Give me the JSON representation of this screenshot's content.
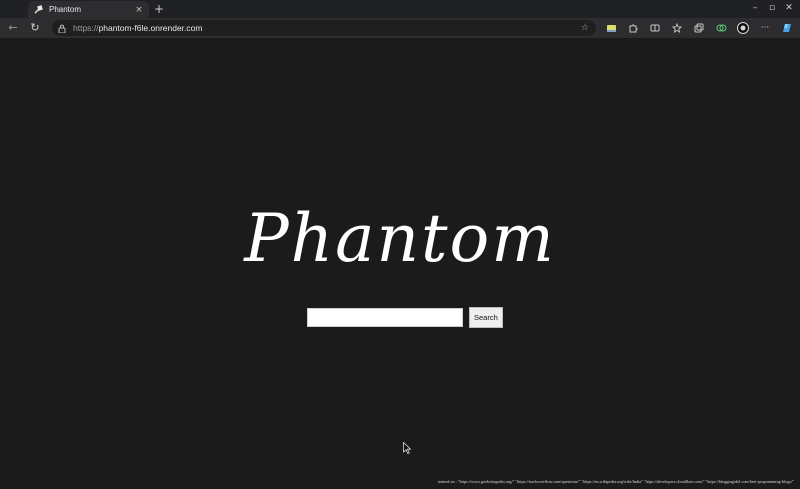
{
  "browser": {
    "tab": {
      "title": "Phantom",
      "close_glyph": "×",
      "favicon": "phantom-favicon"
    },
    "new_tab_glyph": "+",
    "window_controls": [
      "–",
      "▫",
      "✕"
    ],
    "nav": {
      "back_glyph": "←",
      "reload_glyph": "↻"
    },
    "address": {
      "scheme": "https://",
      "host": "phantom-f6le.onrender.com"
    },
    "star_glyph": "☆",
    "extensions": [
      "extension-yellow-icon",
      "extension-puzzle-icon",
      "split-screen-icon",
      "favorites-icon",
      "collections-icon",
      "shopping-icon",
      "profile-icon",
      "more-icon",
      "copilot-icon"
    ],
    "more_glyph": "···"
  },
  "page": {
    "logo": "Phantom",
    "search": {
      "value": "",
      "placeholder": "",
      "button_label": "Search"
    },
    "footer_note": "trained on : \"https://www.geeksforgeeks.org/\" \"https://stackoverflow.com/questions/\" \"https://en.wikipedia.org/wiki/India\" \"https://developers.cloudflare.com/\" \"https://bloggingidol.com/best-programming-blogs/\""
  }
}
